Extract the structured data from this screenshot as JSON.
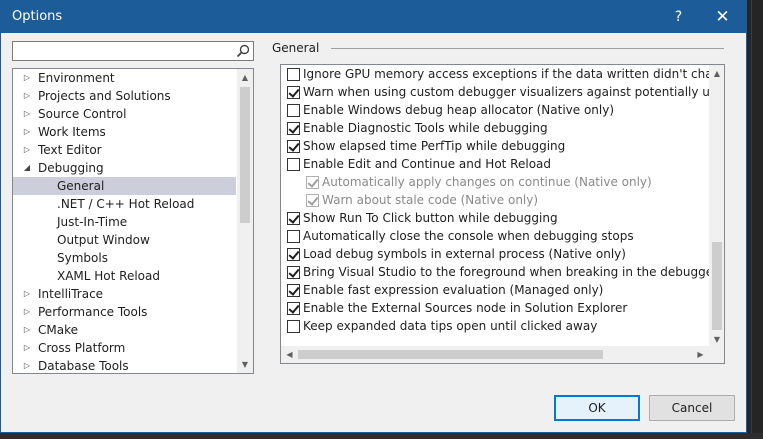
{
  "window": {
    "title": "Options",
    "help_glyph": "?",
    "close_glyph": "✕"
  },
  "search": {
    "value": "",
    "placeholder": ""
  },
  "tree": {
    "items": [
      {
        "label": "Environment",
        "level": 0,
        "expanded": false,
        "selected": false
      },
      {
        "label": "Projects and Solutions",
        "level": 0,
        "expanded": false,
        "selected": false
      },
      {
        "label": "Source Control",
        "level": 0,
        "expanded": false,
        "selected": false
      },
      {
        "label": "Work Items",
        "level": 0,
        "expanded": false,
        "selected": false
      },
      {
        "label": "Text Editor",
        "level": 0,
        "expanded": false,
        "selected": false
      },
      {
        "label": "Debugging",
        "level": 0,
        "expanded": true,
        "selected": false
      },
      {
        "label": "General",
        "level": 1,
        "expanded": null,
        "selected": true
      },
      {
        "label": ".NET / C++ Hot Reload",
        "level": 1,
        "expanded": null,
        "selected": false
      },
      {
        "label": "Just-In-Time",
        "level": 1,
        "expanded": null,
        "selected": false
      },
      {
        "label": "Output Window",
        "level": 1,
        "expanded": null,
        "selected": false
      },
      {
        "label": "Symbols",
        "level": 1,
        "expanded": null,
        "selected": false
      },
      {
        "label": "XAML Hot Reload",
        "level": 1,
        "expanded": null,
        "selected": false
      },
      {
        "label": "IntelliTrace",
        "level": 0,
        "expanded": false,
        "selected": false
      },
      {
        "label": "Performance Tools",
        "level": 0,
        "expanded": false,
        "selected": false
      },
      {
        "label": "CMake",
        "level": 0,
        "expanded": false,
        "selected": false
      },
      {
        "label": "Cross Platform",
        "level": 0,
        "expanded": false,
        "selected": false
      },
      {
        "label": "Database Tools",
        "level": 0,
        "expanded": false,
        "selected": false
      }
    ],
    "scroll_fraction": 0.0
  },
  "section": {
    "title": "General"
  },
  "options": {
    "items": [
      {
        "label": "Ignore GPU memory access exceptions if the data written didn't change the v",
        "checked": false,
        "sub": false
      },
      {
        "label": "Warn when using custom debugger visualizers against potentially unsafe pro",
        "checked": true,
        "sub": false
      },
      {
        "label": "Enable Windows debug heap allocator (Native only)",
        "checked": false,
        "sub": false
      },
      {
        "label": "Enable Diagnostic Tools while debugging",
        "checked": true,
        "sub": false
      },
      {
        "label": "Show elapsed time PerfTip while debugging",
        "checked": true,
        "sub": false
      },
      {
        "label": "Enable Edit and Continue and Hot Reload",
        "checked": false,
        "sub": false
      },
      {
        "label": "Automatically apply changes on continue (Native only)",
        "checked": true,
        "sub": true
      },
      {
        "label": "Warn about stale code (Native only)",
        "checked": true,
        "sub": true
      },
      {
        "label": "Show Run To Click button while debugging",
        "checked": true,
        "sub": false
      },
      {
        "label": "Automatically close the console when debugging stops",
        "checked": false,
        "sub": false
      },
      {
        "label": "Load debug symbols in external process (Native only)",
        "checked": true,
        "sub": false
      },
      {
        "label": "Bring Visual Studio to the foreground when breaking in the debugger",
        "checked": true,
        "sub": false
      },
      {
        "label": "Enable fast expression evaluation (Managed only)",
        "checked": true,
        "sub": false
      },
      {
        "label": "Enable the External Sources node in Solution Explorer",
        "checked": true,
        "sub": false
      },
      {
        "label": "Keep expanded data tips open until clicked away",
        "checked": false,
        "sub": false
      }
    ],
    "scroll_fraction": 1.0
  },
  "buttons": {
    "ok": "OK",
    "cancel": "Cancel"
  }
}
